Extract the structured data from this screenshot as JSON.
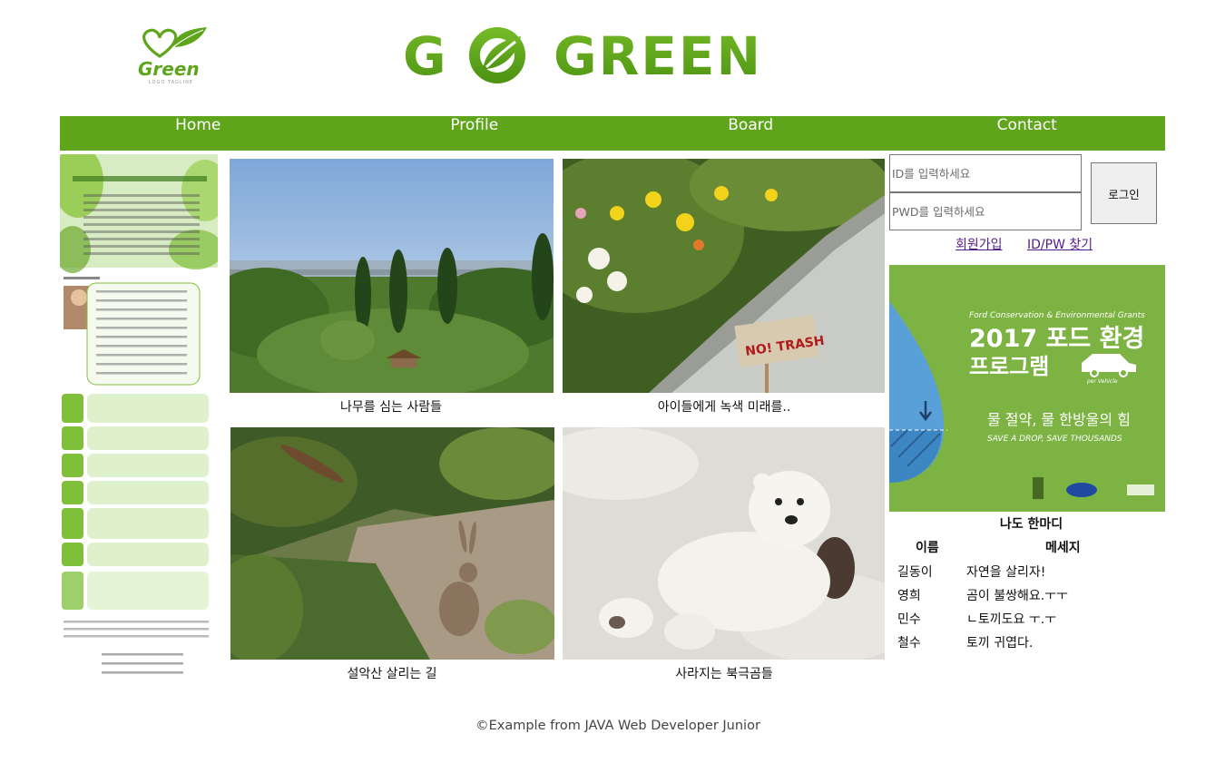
{
  "header": {
    "logo_small_text": "Green",
    "logo_small_tagline": "LOGO TAGLINE",
    "logo_big_text": "GO GREEN"
  },
  "nav": {
    "items": [
      {
        "label": "Home"
      },
      {
        "label": "Profile"
      },
      {
        "label": "Board"
      },
      {
        "label": "Contact"
      }
    ]
  },
  "gallery": {
    "items": [
      {
        "caption": "나무를 심는 사람들"
      },
      {
        "caption": "아이들에게 녹색 미래를.."
      },
      {
        "caption": "설악산 살리는 길"
      },
      {
        "caption": "사라지는 북극곰들"
      }
    ],
    "sign_text": "NO! TRASH"
  },
  "login": {
    "id_placeholder": "ID를 입력하세요",
    "pwd_placeholder": "PWD를 입력하세요",
    "button_label": "로그인",
    "signup_link": "회원가입",
    "find_link": "ID/PW 찾기"
  },
  "ad": {
    "subtitle": "Ford Conservation & Environmental Grants",
    "title_line1": "2017 포드 환경",
    "title_line2": "프로그램",
    "slogan": "물 절약, 물 한방울의 힘",
    "slogan_en": "SAVE A DROP, SAVE THOUSANDS",
    "per_vehicle": "per Vehicle"
  },
  "guestbook": {
    "title": "나도 한마디",
    "col_name": "이름",
    "col_message": "메세지",
    "rows": [
      {
        "name": "길동이",
        "message": "자연을 살리자!"
      },
      {
        "name": "영희",
        "message": "곰이 불쌍해요.ㅜㅜ"
      },
      {
        "name": "민수",
        "message": "ㄴ토끼도요 ㅜ.ㅜ"
      },
      {
        "name": "철수",
        "message": "토끼 귀엽다."
      }
    ]
  },
  "footer": {
    "text": "©Example from JAVA Web Developer Junior"
  },
  "colors": {
    "brand_green": "#5ea51c",
    "nav_text": "#ffffff",
    "visited_link": "#551a8b",
    "ad_background": "#7cb342"
  }
}
